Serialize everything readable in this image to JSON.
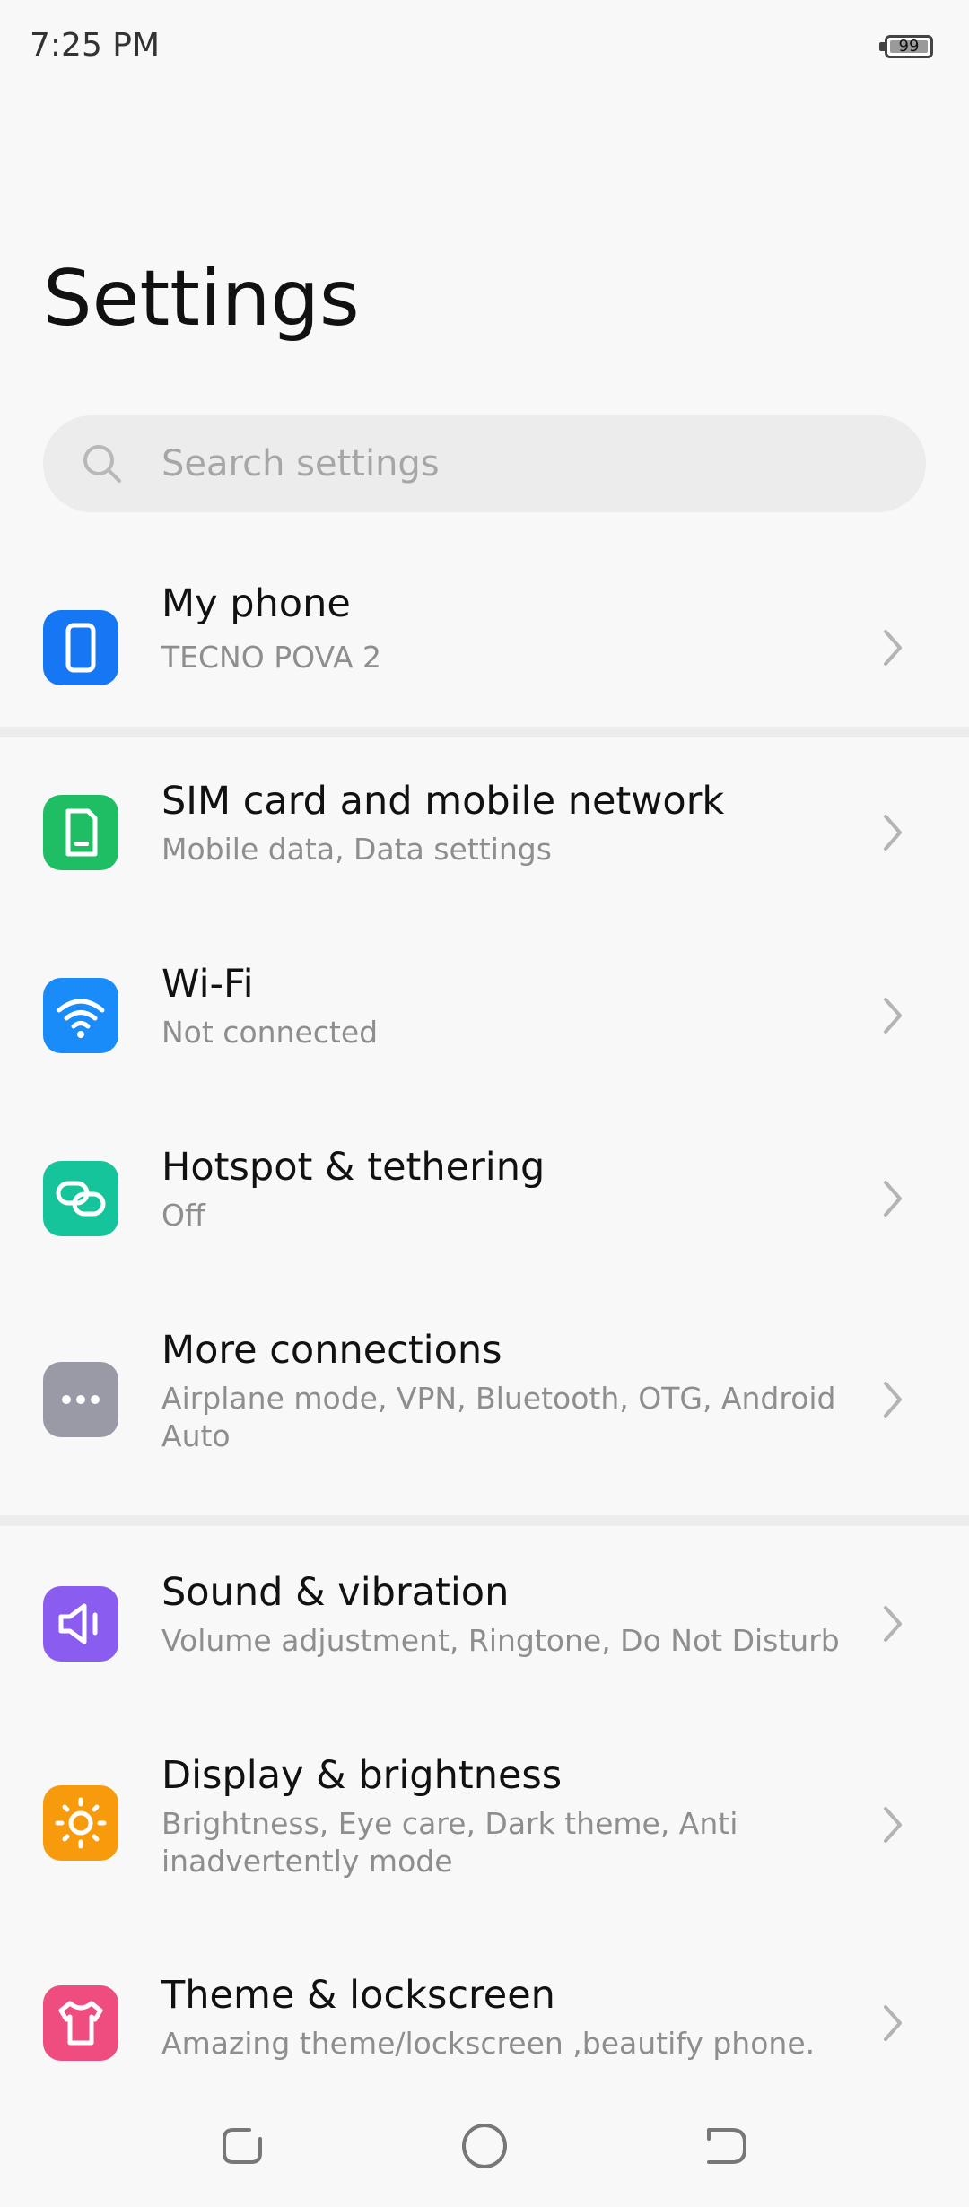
{
  "status_bar": {
    "time": "7:25 PM",
    "battery_percent": "99"
  },
  "header": {
    "title": "Settings"
  },
  "search": {
    "placeholder": "Search settings",
    "icon": "search-icon"
  },
  "items": [
    {
      "title": "My phone",
      "subtitle": "TECNO POVA 2",
      "icon": "phone-icon",
      "color": "#1677f5"
    },
    {
      "title": "SIM card and mobile network",
      "subtitle": "Mobile data, Data settings",
      "icon": "sim-card-icon",
      "color": "#1fbe64"
    },
    {
      "title": "Wi-Fi",
      "subtitle": "Not connected",
      "icon": "wifi-icon",
      "color": "#1a8cfa"
    },
    {
      "title": "Hotspot & tethering",
      "subtitle": "Off",
      "icon": "hotspot-icon",
      "color": "#16c49b"
    },
    {
      "title": "More connections",
      "subtitle": "Airplane mode, VPN, Bluetooth, OTG, Android Auto",
      "icon": "more-icon",
      "color": "#9a99a6"
    },
    {
      "title": "Sound & vibration",
      "subtitle": "Volume adjustment, Ringtone, Do Not Disturb",
      "icon": "speaker-icon",
      "color": "#8b5cf0"
    },
    {
      "title": "Display & brightness",
      "subtitle": "Brightness, Eye care, Dark theme, Anti inadvertently mode",
      "icon": "sun-icon",
      "color": "#f79a0c"
    },
    {
      "title": "Theme & lockscreen",
      "subtitle": "Amazing theme/lockscreen ,beautify phone.",
      "icon": "shirt-icon",
      "color": "#ef4d7f"
    }
  ],
  "nav_bar": {
    "buttons": [
      "recents-button",
      "home-button",
      "back-button"
    ]
  }
}
